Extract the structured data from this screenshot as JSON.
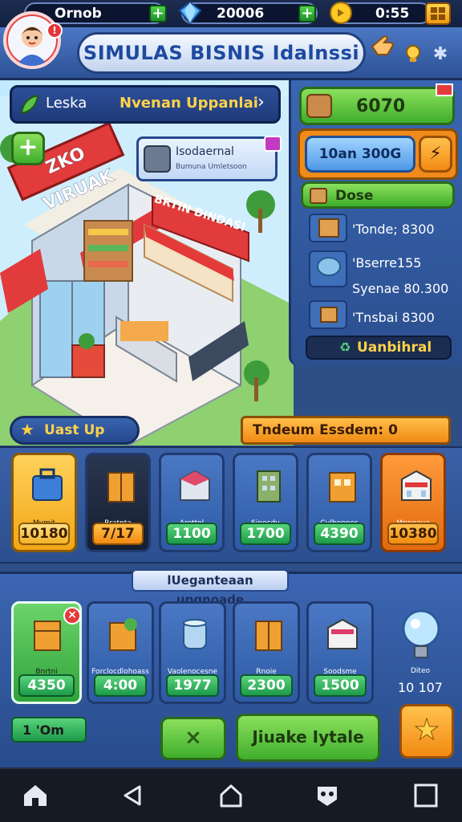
{
  "top_bar": {
    "player_name": "Ornob",
    "gems": "20006",
    "coins": "0:55"
  },
  "header": {
    "title": "SIMULAS BISNIS Idalnssi",
    "notification_badge": "!"
  },
  "scene": {
    "location_label": "Leska",
    "location_value": "Nvenan Uppanlai",
    "store_sign": "ZKO VIRUAK",
    "store_inner_sign": "BRTIN DINDASI",
    "info_title": "Isodaernal",
    "info_sub": "Bumuna Umletsoon"
  },
  "right_panel": {
    "cash": "6070",
    "income": "10an 300G",
    "section": "Dose",
    "items": [
      {
        "label": "'Tonde; 8300"
      },
      {
        "label": "'Bserre155"
      },
      {
        "label": "Syenae 80.300"
      },
      {
        "label": "'Tnsbai 8300"
      }
    ],
    "action": "Uanbihral"
  },
  "bars": {
    "left": "Uast Up",
    "right": "Tndeum Essdem: 0"
  },
  "shop_row": [
    {
      "label": "Mvmit",
      "price": "10180"
    },
    {
      "label": "Bratnta",
      "price": "7/17"
    },
    {
      "label": "Arettol",
      "price": "1100"
    },
    {
      "label": "Sinocdu",
      "price": "1700"
    },
    {
      "label": "Culhonnes",
      "price": "4390"
    },
    {
      "label": "Mnneaua",
      "price": "10380"
    }
  ],
  "upgrade": {
    "title": "lUeganteaan upgnoade",
    "cards": [
      {
        "label": "Bnrtni",
        "price": "4350"
      },
      {
        "label": "Forclocdlohoass",
        "price": "4:00"
      },
      {
        "label": "Vaolenocesne",
        "price": "1977"
      },
      {
        "label": "Rnoie",
        "price": "2300"
      },
      {
        "label": "Soodsme",
        "price": "1500"
      }
    ],
    "extra_label": "Diteo",
    "extra_value": "10 107",
    "counter": "1 'Om",
    "close_button": "×",
    "main_button": "Jiuake Iytale"
  }
}
